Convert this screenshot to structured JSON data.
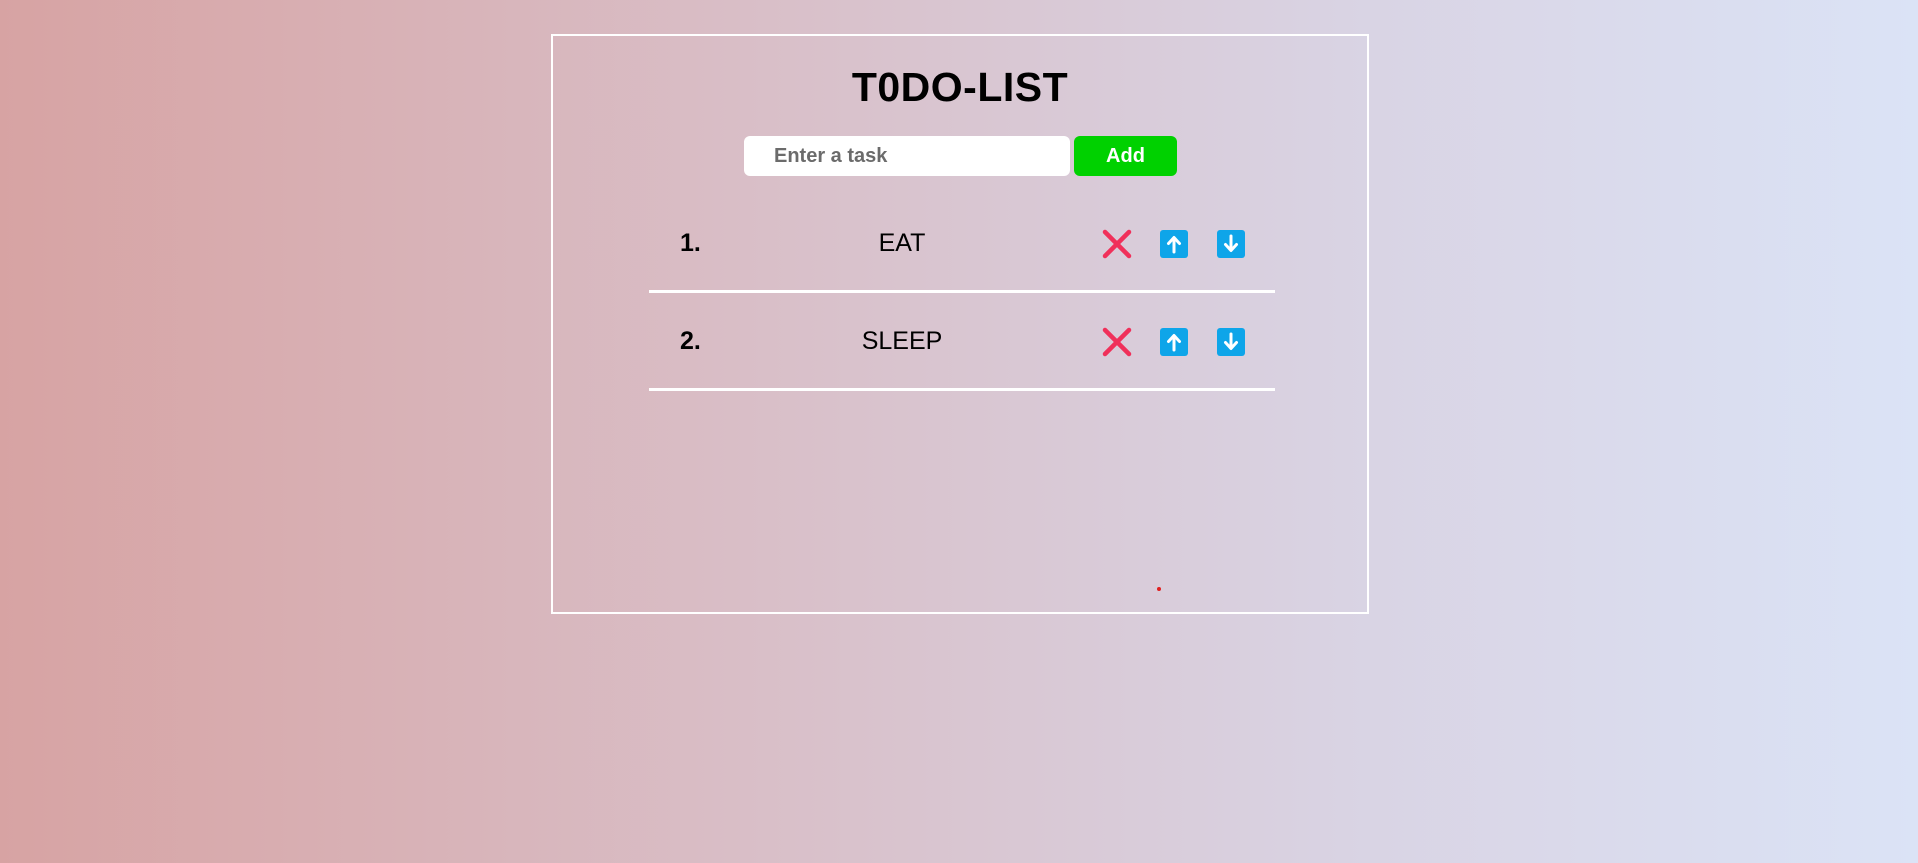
{
  "app": {
    "title": "T0DO-LIST"
  },
  "input": {
    "placeholder": "Enter a task",
    "value": ""
  },
  "add_button": {
    "label": "Add"
  },
  "tasks": [
    {
      "number": "1.",
      "text": "EAT"
    },
    {
      "number": "2.",
      "text": "SLEEP"
    }
  ],
  "icons": {
    "delete": "close-icon",
    "move_up": "arrow-up-icon",
    "move_down": "arrow-down-icon"
  },
  "colors": {
    "add_button": "#00d100",
    "delete_icon": "#f0305a",
    "move_buttons": "#0ea5e9",
    "card_border": "#ffffff"
  }
}
